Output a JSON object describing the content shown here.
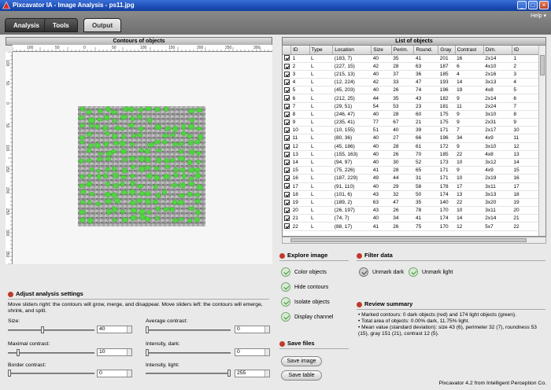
{
  "window": {
    "title": "Pixcavator IA - Image Analysis - ps11.jpg"
  },
  "tabs": [
    {
      "label": "Analysis"
    },
    {
      "label": "Tools"
    },
    {
      "label": "Output"
    }
  ],
  "help": {
    "label": "Help"
  },
  "contours": {
    "title": "Contours of objects",
    "ruler_h_ticks": [
      "100",
      "50",
      "0",
      "50",
      "100",
      "150",
      "200",
      "250",
      "300"
    ],
    "ruler_v_ticks": [
      "100",
      "50",
      "0",
      "50",
      "100",
      "150",
      "200",
      "250",
      "300",
      "350"
    ]
  },
  "list": {
    "title": "List of objects",
    "columns": [
      "ID",
      "Type",
      "Location",
      "Size",
      "Perim.",
      "Round.",
      "Gray",
      "Contrast",
      "Dim.",
      "ID"
    ],
    "rows": [
      [
        "1",
        "L",
        "(183, 7)",
        "40",
        "35",
        "41",
        "201",
        "16",
        "2x14",
        "1"
      ],
      [
        "2",
        "L",
        "(227, 15)",
        "42",
        "28",
        "63",
        "187",
        "6",
        "4x10",
        "2"
      ],
      [
        "3",
        "L",
        "(215, 13)",
        "40",
        "37",
        "36",
        "185",
        "4",
        "2x16",
        "3"
      ],
      [
        "4",
        "L",
        "(12, 224)",
        "42",
        "33",
        "47",
        "193",
        "14",
        "3x13",
        "4"
      ],
      [
        "5",
        "L",
        "(45, 203)",
        "40",
        "26",
        "74",
        "196",
        "19",
        "4x8",
        "5"
      ],
      [
        "6",
        "L",
        "(212, 25)",
        "44",
        "35",
        "43",
        "182",
        "9",
        "2x14",
        "6"
      ],
      [
        "7",
        "L",
        "(29, 51)",
        "54",
        "53",
        "23",
        "181",
        "11",
        "2x24",
        "7"
      ],
      [
        "8",
        "L",
        "(246, 47)",
        "40",
        "28",
        "60",
        "175",
        "9",
        "3x10",
        "8"
      ],
      [
        "9",
        "L",
        "(235, 41)",
        "77",
        "67",
        "21",
        "175",
        "9",
        "2x31",
        "9"
      ],
      [
        "10",
        "L",
        "(10, 155)",
        "51",
        "40",
        "39",
        "171",
        "7",
        "2x17",
        "10"
      ],
      [
        "11",
        "L",
        "(80, 36)",
        "40",
        "27",
        "66",
        "196",
        "34",
        "4x9",
        "11"
      ],
      [
        "12",
        "L",
        "(45, 186)",
        "40",
        "28",
        "61",
        "172",
        "9",
        "3x10",
        "12"
      ],
      [
        "13",
        "L",
        "(155, 163)",
        "40",
        "26",
        "70",
        "185",
        "22",
        "4x8",
        "13"
      ],
      [
        "14",
        "L",
        "(94, 97)",
        "40",
        "30",
        "52",
        "173",
        "10",
        "3x12",
        "14"
      ],
      [
        "15",
        "L",
        "(75, 226)",
        "41",
        "28",
        "65",
        "171",
        "9",
        "4x9",
        "15"
      ],
      [
        "16",
        "L",
        "(187, 229)",
        "49",
        "44",
        "31",
        "171",
        "10",
        "2x19",
        "16"
      ],
      [
        "17",
        "L",
        "(91, 110)",
        "40",
        "29",
        "58",
        "178",
        "17",
        "3x11",
        "17"
      ],
      [
        "18",
        "L",
        "(101, 6)",
        "43",
        "32",
        "50",
        "174",
        "13",
        "3x13",
        "18"
      ],
      [
        "19",
        "L",
        "(189, 2)",
        "63",
        "47",
        "35",
        "140",
        "22",
        "3x20",
        "19"
      ],
      [
        "20",
        "L",
        "(26, 197)",
        "43",
        "26",
        "78",
        "170",
        "10",
        "3x11",
        "20"
      ],
      [
        "21",
        "L",
        "(74, 7)",
        "40",
        "34",
        "41",
        "174",
        "14",
        "2x14",
        "21"
      ],
      [
        "22",
        "L",
        "(88, 17)",
        "41",
        "26",
        "75",
        "170",
        "12",
        "5x7",
        "22"
      ]
    ]
  },
  "explore": {
    "title": "Explore image",
    "options": [
      "Color objects",
      "Hide contours",
      "Isolate objects",
      "Display channel"
    ]
  },
  "filter": {
    "title": "Filter data",
    "options": [
      "Unmark dark",
      "Unmark light"
    ]
  },
  "review": {
    "title": "Review summary",
    "lines": [
      "• Marked contours: 0 dark objects (red) and 174 light objects (green).",
      "• Total area of objects: 0.00% dark, 11.75% light.",
      "• Mean value (standard deviation): size 43 (6), perimeter 32 (7), roundness 53",
      "(15), gray 151 (21), contrast 12 (5)."
    ]
  },
  "save": {
    "title": "Save files",
    "buttons": [
      "Save image",
      "Save table"
    ]
  },
  "adjust": {
    "title": "Adjust analysis settings",
    "description": "Move sliders right: the contours will grow, merge, and disappear. Move sliders left: the contours will emerge, shrink, and split.",
    "size": {
      "label": "Size:",
      "value": "40",
      "level": 0.4
    },
    "avg_contrast": {
      "label": "Average contrast:",
      "value": "0",
      "level": 0
    },
    "max_contrast": {
      "label": "Maximal contrast:",
      "value": "10",
      "level": 0.1
    },
    "intensity_dark": {
      "label": "Intensity, dark:",
      "value": "0",
      "level": 0
    },
    "border_contrast": {
      "label": "Border contrast:",
      "value": "0",
      "level": 0
    },
    "intensity_light": {
      "label": "Intensity, light:",
      "value": "255",
      "level": 1
    }
  },
  "footer": {
    "text": "Pixcavator 4.2 from Intelligent Perception Co."
  },
  "colors": {
    "object_contour": "#44dd33",
    "accent_dot": "#c0392b",
    "title_bar": "#1d4fb8"
  }
}
